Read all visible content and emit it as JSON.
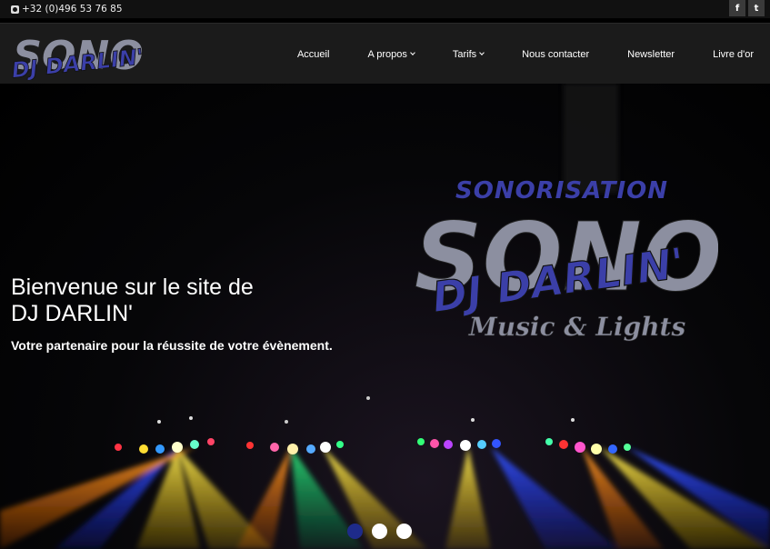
{
  "topbar": {
    "phone": "+32 (0)496 53 76 85",
    "social": [
      {
        "label": "f",
        "icon": "facebook-icon"
      },
      {
        "label": "t",
        "icon": "twitter-icon"
      }
    ]
  },
  "logo": {
    "text": "DJ DARLIN'",
    "bg_text": "SONO",
    "color": "#3b3fa8"
  },
  "menu": [
    {
      "label": "Accueil",
      "dropdown": false
    },
    {
      "label": "A propos",
      "dropdown": true
    },
    {
      "label": "Tarifs",
      "dropdown": true
    },
    {
      "label": "Nous contacter",
      "dropdown": false
    },
    {
      "label": "Newsletter",
      "dropdown": false
    },
    {
      "label": "Livre d'or",
      "dropdown": false
    }
  ],
  "hero": {
    "title_line1": "Bienvenue sur le site de",
    "title_line2": "DJ DARLIN'",
    "subtitle": "Votre partenaire pour la réussite de votre évènement.",
    "brand_top": "SONORISATION",
    "brand_sono": "SONO",
    "brand_dj": "DJ DARLIN'",
    "brand_bottom": "Music & Lights"
  },
  "slider": {
    "count": 3,
    "active_index": 0
  },
  "colors": {
    "brand_blue": "#3b3fa8",
    "brand_grey": "#8c8fa0",
    "nav_bg": "#1b1b1b"
  }
}
